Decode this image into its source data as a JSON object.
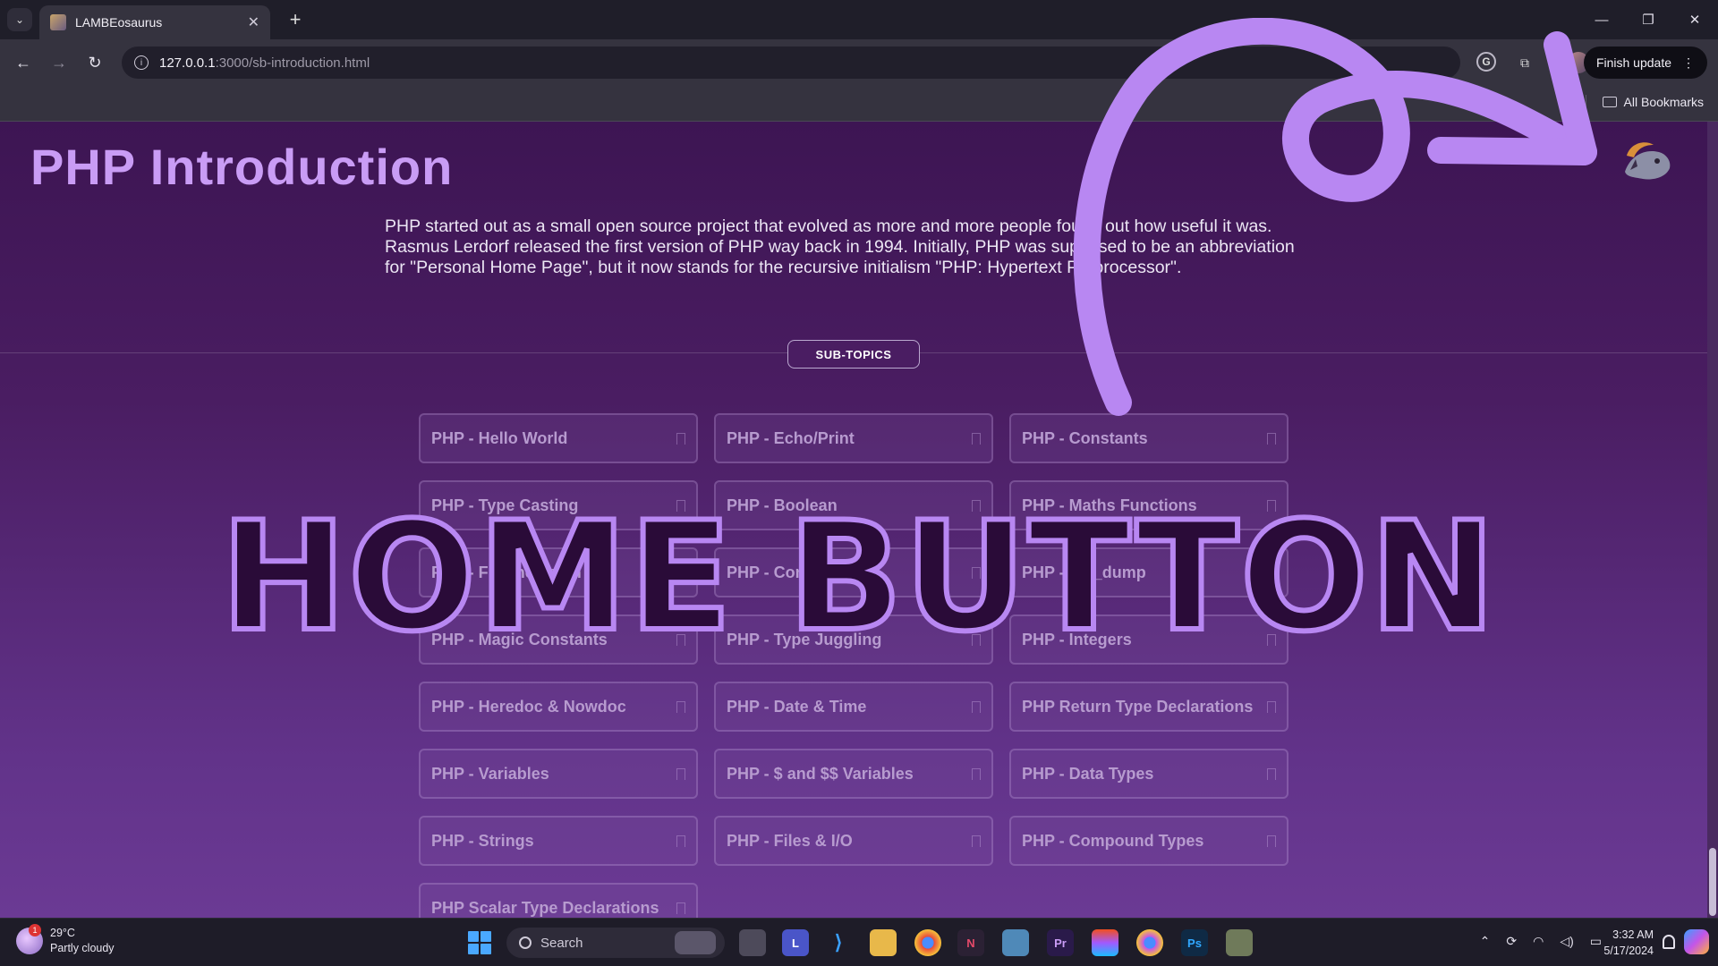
{
  "browser": {
    "tab_title": "LAMBEosaurus",
    "url_host": "127.0.0.1",
    "url_path": ":3000/sb-introduction.html",
    "finish_update_label": "Finish update",
    "all_bookmarks_label": "All Bookmarks",
    "new_tab_glyph": "+",
    "close_glyph": "✕"
  },
  "page": {
    "title": "PHP Introduction",
    "intro": "PHP started out as a small open source project that evolved as more and more people found out how useful it was. Rasmus Lerdorf released the first version of PHP way back in 1994. Initially, PHP was supposed to be an abbreviation for \"Personal Home Page\", but it now stands for the recursive initialism \"PHP: Hypertext Preprocessor\".",
    "subtopics_label": "SUB-TOPICS",
    "cards": [
      "PHP - Hello World",
      "PHP - Echo/Print",
      "PHP - Constants",
      "PHP - Type Casting",
      "PHP - Boolean",
      "PHP - Maths Functions",
      "PHP - File Inclusion",
      "PHP - Comments",
      "PHP - var_dump",
      "PHP - Magic Constants",
      "PHP - Type Juggling",
      "PHP - Integers",
      "PHP - Heredoc & Nowdoc",
      "PHP - Date & Time",
      "PHP Return Type Declarations",
      "PHP - Variables",
      "PHP - $ and $$ Variables",
      "PHP - Data Types",
      "PHP - Strings",
      "PHP - Files & I/O",
      "PHP - Compound Types",
      "PHP Scalar Type Declarations"
    ]
  },
  "overlay": {
    "text": "HOME BUTTON",
    "stroke_color": "#b887f2",
    "fill_color": "#2a0b38"
  },
  "taskbar": {
    "temperature": "29°C",
    "weather": "Partly cloudy",
    "weather_badge": "1",
    "search_placeholder": "Search",
    "time": "3:32 AM",
    "date": "5/17/2024",
    "apps": [
      "L",
      "Pr",
      "Ps",
      "N"
    ]
  },
  "colors": {
    "accent_title": "#c99cf5",
    "page_top": "#3d1553",
    "page_bottom": "#6b3a94"
  }
}
